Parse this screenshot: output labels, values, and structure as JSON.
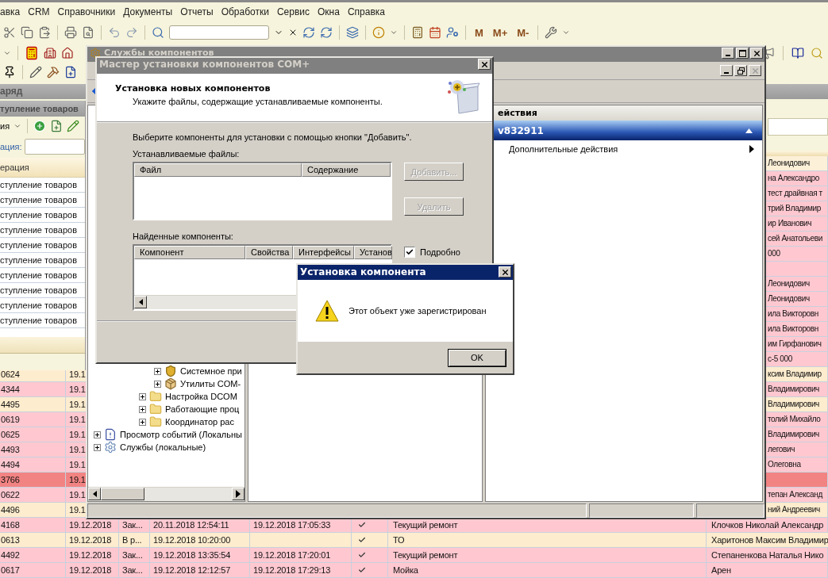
{
  "app": {
    "menu": [
      "авка",
      "CRM",
      "Справочники",
      "Документы",
      "Отчеты",
      "Обработки",
      "Сервис",
      "Окна",
      "Справка"
    ],
    "toolbar": {
      "memory_buttons": [
        "M",
        "M+",
        "M-"
      ]
    },
    "document_window": {
      "title": "аряд"
    },
    "table": {
      "rows": [
        {
          "kind": "partial",
          "color": "#fdf0d8",
          "name": "Леонидович"
        },
        {
          "kind": "partial",
          "color": "#ffc8d0",
          "name": "на Александро"
        },
        {
          "kind": "partial",
          "color": "#ffc8d0",
          "name": "тест драйвная т"
        },
        {
          "kind": "partial",
          "color": "#ffc8d0",
          "name": "трий Владимир"
        },
        {
          "kind": "partial",
          "color": "#ffc8d0",
          "name": "ир Иванович"
        },
        {
          "kind": "partial",
          "color": "#ffc8d0",
          "name": "сей Анатольеви"
        },
        {
          "kind": "partial",
          "color": "#ffc8d0",
          "name": "000"
        },
        {
          "kind": "partial",
          "color": "#ffc8d0"
        },
        {
          "kind": "partial",
          "color": "#ffc8d0",
          "name": "Леонидович"
        },
        {
          "kind": "partial",
          "color": "#ffc8d0",
          "name": "Леонидович"
        },
        {
          "kind": "partial",
          "color": "#ffc8d0",
          "name": "ила Викторовн"
        },
        {
          "kind": "partial",
          "color": "#ffc8d0",
          "name": "ила Викторовн"
        },
        {
          "kind": "partial",
          "color": "#ffc8d0",
          "name": "им Гирфанович"
        },
        {
          "kind": "partial",
          "color": "#ffc8d0",
          "name": "с-5 000"
        },
        {
          "kind": "partial",
          "color": "#fdecce",
          "number": "0624",
          "date": "19.1",
          "name": "ксим Владимир"
        },
        {
          "kind": "partial",
          "color": "#ffc8d0",
          "number": "4344",
          "date": "19.1",
          "name": "Владимирович"
        },
        {
          "kind": "partial",
          "color": "#fdecce",
          "number": "4495",
          "date": "19.1",
          "name": "Владимирович"
        },
        {
          "kind": "partial",
          "color": "#ffc8d0",
          "number": "0619",
          "date": "19.1",
          "name": "толий Михайло"
        },
        {
          "kind": "partial",
          "color": "#ffc8d0",
          "number": "0625",
          "date": "19.1",
          "name": "Владимирович"
        },
        {
          "kind": "partial",
          "color": "#ffc8d0",
          "number": "4493",
          "date": "19.1",
          "name": "легович"
        },
        {
          "kind": "partial",
          "color": "#ffc8d0",
          "number": "4494",
          "date": "19.1",
          "name": "Олеговна"
        },
        {
          "kind": "partial",
          "color": "#f28383",
          "number": "3766",
          "date": "19.1"
        },
        {
          "kind": "partial",
          "color": "#ffc8d0",
          "number": "0622",
          "date": "19.1",
          "name": "тепан Александ"
        },
        {
          "kind": "partial",
          "color": "#fdecce",
          "number": "4496",
          "date": "19.1",
          "name": "ний Андреевич"
        },
        {
          "kind": "full",
          "color": "#ffc8d0",
          "number": "4168",
          "date": "19.12.2018",
          "status": "Зак...",
          "start": "20.11.2018 12:54:11",
          "end": "19.12.2018 17:05:33",
          "done": true,
          "type": "Текущий ремонт",
          "name": "Клочков Николай  Александр"
        },
        {
          "kind": "full",
          "color": "#fdecce",
          "number": "0613",
          "date": "19.12.2018",
          "status": "В р...",
          "start": "19.12.2018 10:20:00",
          "done": true,
          "type": "ТО",
          "name": "Харитонов Максим Владимир"
        },
        {
          "kind": "full",
          "color": "#ffc8d0",
          "number": "4492",
          "date": "19.12.2018",
          "status": "Зак...",
          "start": "19.12.2018 13:35:54",
          "end": "19.12.2018 17:20:01",
          "done": true,
          "type": "Текущий ремонт",
          "name": "Степаненкова Наталья  Нико"
        },
        {
          "kind": "full",
          "color": "#ffc8d0",
          "number": "0617",
          "date": "19.12.2018",
          "status": "Зак...",
          "start": "19.12.2018 12:12:57",
          "end": "19.12.2018 17:29:13",
          "done": true,
          "type": "Мойка",
          "name": "Арен"
        }
      ]
    }
  },
  "receipts_window": {
    "title": "тупление товаров",
    "actions_label": "ия",
    "filter_label": "ация:",
    "column": "ерация",
    "rows": [
      "ступление товаров",
      "ступление товаров",
      "ступление товаров",
      "ступление товаров",
      "ступление товаров",
      "ступление товаров",
      "ступление товаров",
      "ступление товаров",
      "ступление товаров",
      "ступление товаров"
    ]
  },
  "component_services": {
    "title": "Службы компонентов",
    "tree": [
      {
        "children": [
          {
            "children": [
              {
                "children": [
                  {
                    "children": [
                      {
                        "label": "Системное при",
                        "kind": "application",
                        "expanded": false
                      },
                      {
                        "label": "Утилиты COM-",
                        "kind": "utility",
                        "expanded": false
                      }
                    ]
                  },
                  {
                    "label": "Настройка DCOM",
                    "kind": "folder",
                    "expanded": false
                  },
                  {
                    "label": "Работающие проц",
                    "kind": "folder",
                    "expanded": false
                  },
                  {
                    "label": "Координатор рас",
                    "kind": "folder",
                    "expanded": false
                  }
                ]
              }
            ]
          }
        ]
      },
      {
        "label": "Просмотр событий (Локальны",
        "kind": "events",
        "expanded": false
      },
      {
        "label": "Службы (локальные)",
        "kind": "services",
        "expanded": false
      }
    ],
    "actions": {
      "header": "ействия",
      "group": "v832911",
      "group_expanded": true,
      "items": [
        "Дополнительные действия"
      ]
    }
  },
  "wizard": {
    "title": "Мастер установки компонентов COM+",
    "heading": "Установка новых компонентов",
    "subheading": "Укажите файлы, содержащие устанавливаемые компоненты.",
    "instruction": "Выберите компоненты для установки с помощью кнопки \"Добавить\".",
    "files_label": "Устанавливаемые файлы:",
    "files_columns": [
      "Файл",
      "Содержание"
    ],
    "buttons": [
      {
        "label": "Добавить...",
        "disabled": true
      },
      {
        "label": "Удалить",
        "disabled": true
      }
    ],
    "found_label": "Найденные компоненты:",
    "found_columns": [
      "Компонент",
      "Свойства",
      "Интерфейсы",
      "Установ"
    ],
    "details": {
      "label": "Подробно",
      "checked": true
    }
  },
  "message_box": {
    "title": "Установка компонента",
    "message": "Этот объект уже зарегистрирован",
    "button": "OK"
  }
}
